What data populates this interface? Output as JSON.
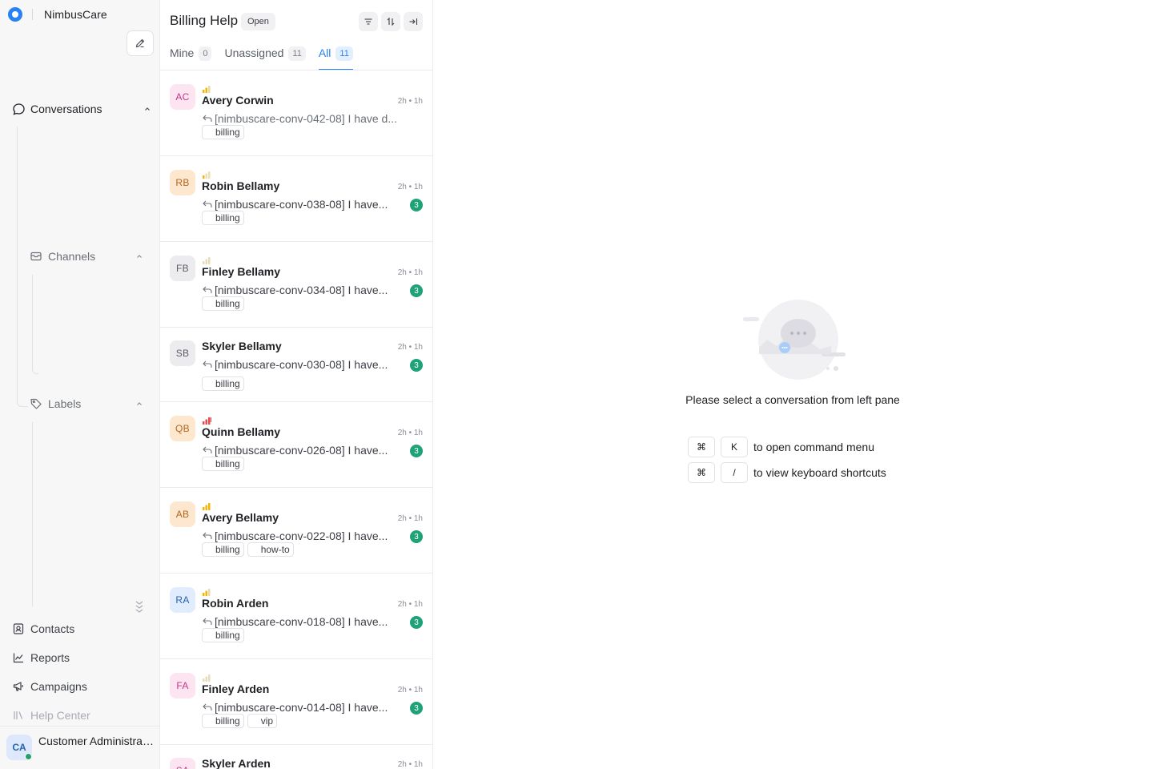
{
  "sidebar": {
    "brand": "NimbusCare",
    "conversations_label": "Conversations",
    "channels_label": "Channels",
    "labels_label": "Labels",
    "contacts_label": "Contacts",
    "reports_label": "Reports",
    "campaigns_label": "Campaigns",
    "help_center_label": "Help Center",
    "profile": {
      "initials": "CA",
      "name": "Customer Administrator",
      "status": "online"
    }
  },
  "list": {
    "title": "Billing Help",
    "status": "Open",
    "tabs": [
      {
        "label": "Mine",
        "count": "0"
      },
      {
        "label": "Unassigned",
        "count": "11"
      },
      {
        "label": "All",
        "count": "11",
        "active": true
      }
    ],
    "conversations": [
      {
        "initials": "AC",
        "name": "Avery Corwin",
        "time": "2h • 1h",
        "message": "[nimbuscare-conv-042-08] I have d...",
        "unread": "",
        "priority": "medium",
        "labels": [
          "billing"
        ],
        "avatar_bg": "#fde4f1",
        "avatar_fg": "#c0398a"
      },
      {
        "initials": "RB",
        "name": "Robin Bellamy",
        "time": "2h • 1h",
        "message": "[nimbuscare-conv-038-08] I have...",
        "unread": "3",
        "priority": "low",
        "labels": [
          "billing"
        ],
        "avatar_bg": "#fde8cf",
        "avatar_fg": "#b5651d"
      },
      {
        "initials": "FB",
        "name": "Finley Bellamy",
        "time": "2h • 1h",
        "message": "[nimbuscare-conv-034-08] I have...",
        "unread": "3",
        "priority": "none",
        "labels": [
          "billing"
        ],
        "avatar_bg": "#ececee",
        "avatar_fg": "#5a5e66"
      },
      {
        "initials": "SB",
        "name": "Skyler Bellamy",
        "time": "2h • 1h",
        "message": "[nimbuscare-conv-030-08] I have...",
        "unread": "3",
        "priority": "hidden",
        "labels": [
          "billing"
        ],
        "avatar_bg": "#ececee",
        "avatar_fg": "#5a5e66"
      },
      {
        "initials": "QB",
        "name": "Quinn Bellamy",
        "time": "2h • 1h",
        "message": "[nimbuscare-conv-026-08] I have...",
        "unread": "3",
        "priority": "urgent",
        "labels": [
          "billing"
        ],
        "avatar_bg": "#fde8cf",
        "avatar_fg": "#b5651d"
      },
      {
        "initials": "AB",
        "name": "Avery Bellamy",
        "time": "2h • 1h",
        "message": "[nimbuscare-conv-022-08] I have...",
        "unread": "3",
        "priority": "high",
        "labels": [
          "billing",
          "how-to"
        ],
        "avatar_bg": "#fde8cf",
        "avatar_fg": "#b5651d"
      },
      {
        "initials": "RA",
        "name": "Robin Arden",
        "time": "2h • 1h",
        "message": "[nimbuscare-conv-018-08] I have...",
        "unread": "3",
        "priority": "medium",
        "labels": [
          "billing"
        ],
        "avatar_bg": "#e1ecfd",
        "avatar_fg": "#2563b0"
      },
      {
        "initials": "FA",
        "name": "Finley Arden",
        "time": "2h • 1h",
        "message": "[nimbuscare-conv-014-08] I have...",
        "unread": "3",
        "priority": "none",
        "labels": [
          "billing",
          "vip"
        ],
        "avatar_bg": "#fde4f1",
        "avatar_fg": "#c0398a"
      },
      {
        "initials": "SA",
        "name": "Skyler Arden",
        "time": "2h • 1h",
        "message": "",
        "unread": "",
        "priority": "hidden",
        "labels": [],
        "avatar_bg": "#fde4f1",
        "avatar_fg": "#c0398a"
      }
    ]
  },
  "empty_state": {
    "message": "Please select a conversation from left pane",
    "shortcuts": [
      {
        "keys": [
          "⌘",
          "K"
        ],
        "description": "to open command menu"
      },
      {
        "keys": [
          "⌘",
          "/"
        ],
        "description": "to view keyboard shortcuts"
      }
    ]
  },
  "colors": {
    "accent": "#2781f6",
    "unread_badge": "#1fa277",
    "priority_urgent": "#e5484d",
    "priority_medium": "#f5b400"
  }
}
